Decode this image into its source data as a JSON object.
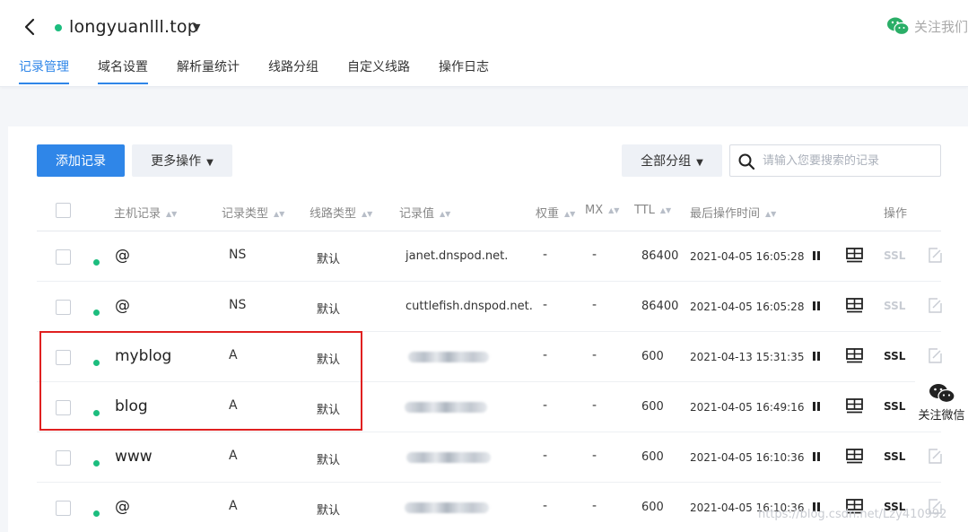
{
  "header": {
    "domain": "longyuanlll.top",
    "follow_us": "关注我们"
  },
  "tabs": [
    {
      "label": "记录管理",
      "active": true
    },
    {
      "label": "域名设置",
      "active": false
    },
    {
      "label": "解析量统计",
      "active": false
    },
    {
      "label": "线路分组",
      "active": false
    },
    {
      "label": "自定义线路",
      "active": false
    },
    {
      "label": "操作日志",
      "active": false
    }
  ],
  "toolbar": {
    "add_label": "添加记录",
    "more_label": "更多操作",
    "group_label": "全部分组",
    "search_placeholder": "请输入您要搜索的记录"
  },
  "table": {
    "columns": [
      "主机记录",
      "记录类型",
      "线路类型",
      "记录值",
      "权重",
      "MX",
      "TTL",
      "最后操作时间",
      "操作"
    ],
    "rows": [
      {
        "host": "@",
        "type": "NS",
        "line": "默认",
        "value": "janet.dnspod.net.",
        "weight": "-",
        "mx": "-",
        "ttl": "86400",
        "time": "2021-04-05 16:05:28",
        "ssl": "SSL"
      },
      {
        "host": "@",
        "type": "NS",
        "line": "默认",
        "value": "cuttlefish.dnspod.net.",
        "weight": "-",
        "mx": "-",
        "ttl": "86400",
        "time": "2021-04-05 16:05:28",
        "ssl": "SSL"
      },
      {
        "host": "myblog",
        "type": "A",
        "line": "默认",
        "value": "",
        "weight": "-",
        "mx": "-",
        "ttl": "600",
        "time": "2021-04-13 15:31:35",
        "ssl": "SSL"
      },
      {
        "host": "blog",
        "type": "A",
        "line": "默认",
        "value": "",
        "weight": "-",
        "mx": "-",
        "ttl": "600",
        "time": "2021-04-05 16:49:16",
        "ssl": "SSL"
      },
      {
        "host": "www",
        "type": "A",
        "line": "默认",
        "value": "",
        "weight": "-",
        "mx": "-",
        "ttl": "600",
        "time": "2021-04-05 16:10:36",
        "ssl": "SSL"
      },
      {
        "host": "@",
        "type": "A",
        "line": "默认",
        "value": "",
        "weight": "-",
        "mx": "-",
        "ttl": "600",
        "time": "2021-04-05 16:10:36",
        "ssl": "SSL"
      }
    ]
  },
  "side": {
    "follow_wechat": "关注微信"
  },
  "watermark": "https://blog.csdn.net/Lzy410992",
  "colors": {
    "accent": "#2f86e8",
    "status_green": "#1cbd7e",
    "ssl_disabled": "#c8ccd3",
    "highlight_red": "#e02020"
  }
}
